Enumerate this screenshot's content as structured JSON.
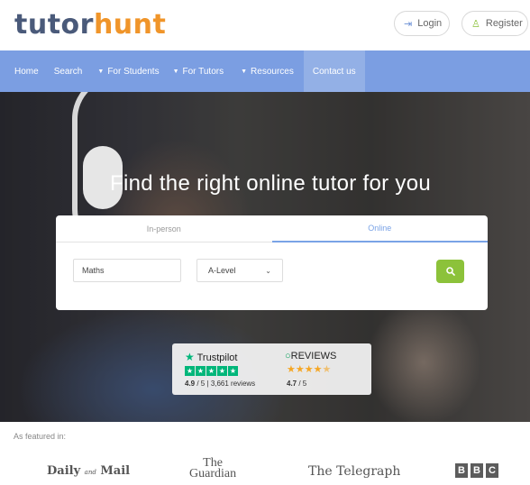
{
  "brand": {
    "part1": "tutor",
    "part2": "hunt"
  },
  "auth": {
    "login_label": "Login",
    "register_label": "Register"
  },
  "nav": [
    {
      "label": "Home",
      "caret": false
    },
    {
      "label": "Search",
      "caret": false
    },
    {
      "label": "For Students",
      "caret": true
    },
    {
      "label": "For Tutors",
      "caret": true
    },
    {
      "label": "Resources",
      "caret": true
    },
    {
      "label": "Contact us",
      "caret": false,
      "active": true
    }
  ],
  "hero": {
    "title": "Find the right online tutor for you"
  },
  "search": {
    "tabs": [
      {
        "label": "In-person",
        "active": false
      },
      {
        "label": "Online",
        "active": true
      }
    ],
    "subject_value": "Maths",
    "level_value": "A-Level",
    "button_icon": "search-icon"
  },
  "reviews": {
    "trustpilot": {
      "name": "Trustpilot",
      "rating": "4.9",
      "out_of": "/ 5",
      "separator": "|",
      "count": "3,661 reviews"
    },
    "reviewsio": {
      "name": "REVIEWS",
      "rating": "4.7",
      "out_of": "/ 5"
    }
  },
  "featured": {
    "label": "As featured in:",
    "press": {
      "mail_1": "Daily",
      "mail_small": "and",
      "mail_2": "Mail",
      "guardian_1": "The",
      "guardian_2": "Guardian",
      "telegraph": "The Telegraph",
      "bbc": [
        "B",
        "B",
        "C"
      ]
    }
  },
  "colors": {
    "nav_bg": "#7b9ee2",
    "accent_green": "#8cc23a",
    "logo_orange": "#f0952a",
    "logo_navy": "#4a5a7a",
    "trustpilot_green": "#00b67a"
  }
}
